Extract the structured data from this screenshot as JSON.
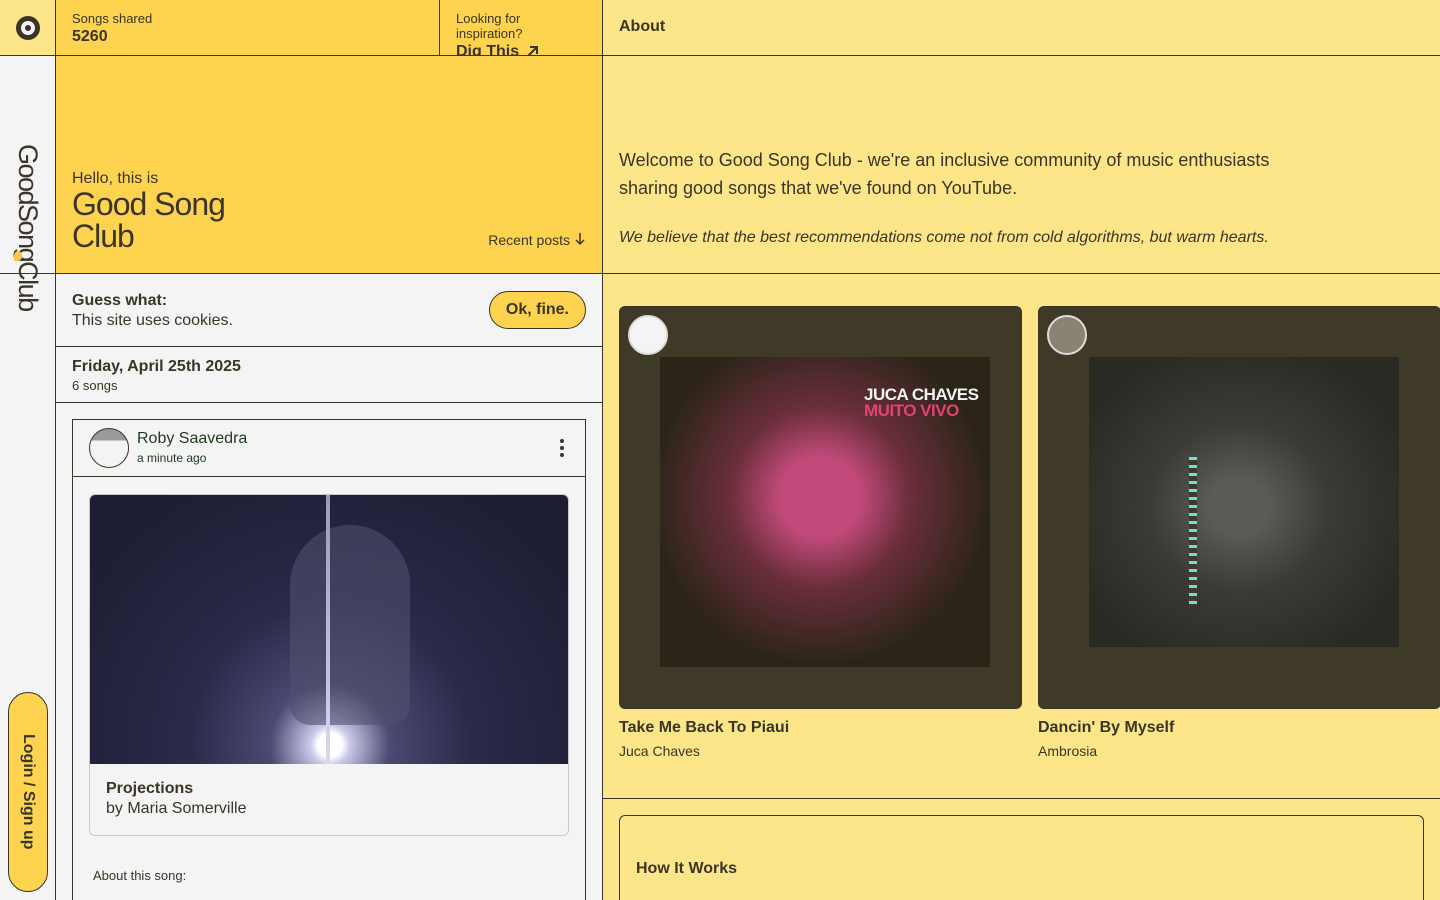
{
  "rail": {
    "brand": "GoodSongClub",
    "login_label": "Login / Sign up"
  },
  "topbar": {
    "songs_label": "Songs shared",
    "songs_value": "5260",
    "inspiration_label": "Looking for inspiration?",
    "dig_label": "Dig This",
    "about_label": "About"
  },
  "hero": {
    "hello": "Hello, this is",
    "title": "Good Song Club",
    "recent_label": "Recent posts"
  },
  "about": {
    "intro": "Welcome to Good Song Club - we're an inclusive community of music enthusiasts sharing good songs that we've found on YouTube.",
    "quote": "We believe that the best recommendations come not from cold algorithms, but warm hearts."
  },
  "cookie": {
    "heading": "Guess what:",
    "text": "This site uses cookies.",
    "ok_label": "Ok, fine."
  },
  "feed": {
    "date": "Friday, April 25th 2025",
    "count": "6 songs",
    "post": {
      "user": "Roby Saavedra",
      "time": "a minute ago",
      "song_title": "Projections",
      "song_artist": "by Maria Somerville",
      "about_label": "About this song:"
    }
  },
  "grid": {
    "tiles": [
      {
        "title": "Take Me Back To Piaui",
        "artist": "Juca Chaves",
        "cover_line1": "JUCA CHAVES",
        "cover_line2": "MUITO VIVO"
      },
      {
        "title": "Dancin' By Myself",
        "artist": "Ambrosia"
      }
    ]
  },
  "how": {
    "title": "How It Works"
  },
  "colors": {
    "accent": "#fdd34f",
    "pale": "#fde58a",
    "ink": "#3a3526"
  }
}
